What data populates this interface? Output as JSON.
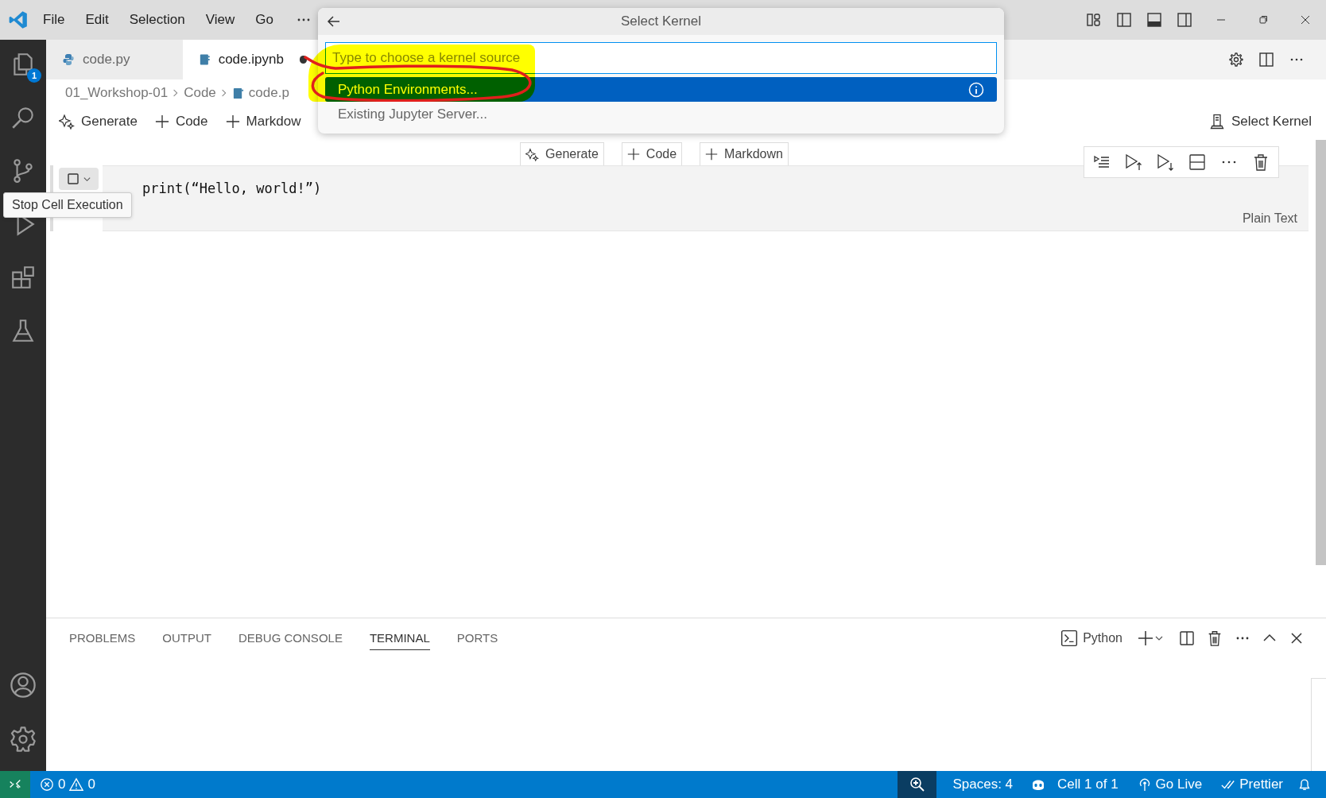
{
  "menu": [
    "File",
    "Edit",
    "Selection",
    "View",
    "Go"
  ],
  "activity_bar": {
    "explorer_badge": "1"
  },
  "tabs": [
    {
      "label": "code.py",
      "kind": "python",
      "selected": false,
      "dirty": false
    },
    {
      "label": "code.ipynb",
      "kind": "notebook",
      "selected": true,
      "dirty": true
    }
  ],
  "breadcrumb": [
    {
      "label": "01_Workshop-01",
      "kind": "folder"
    },
    {
      "label": "Code",
      "kind": "folder"
    },
    {
      "label": "code.p",
      "kind": "notebook"
    }
  ],
  "notebook_toolbar": {
    "items": [
      {
        "label": "Generate",
        "kind": "sparkle"
      },
      {
        "label": "Code",
        "kind": "plus"
      },
      {
        "label": "Markdow",
        "kind": "plus"
      }
    ],
    "kernel": "Select Kernel"
  },
  "insert_bar": [
    {
      "label": "Generate",
      "kind": "sparkle"
    },
    {
      "label": "Code",
      "kind": "plus"
    },
    {
      "label": "Markdown",
      "kind": "plus"
    }
  ],
  "cell": {
    "code": "print(“Hello, world!”)",
    "language": "Plain Text"
  },
  "tooltip": "Stop Cell Execution",
  "quick_pick": {
    "title": "Select Kernel",
    "placeholder": "Type to choose a kernel source",
    "items": [
      {
        "label": "Python Environments...",
        "selected": true
      },
      {
        "label": "Existing Jupyter Server...",
        "selected": false
      }
    ]
  },
  "panel": {
    "tabs": [
      {
        "label": "PROBLEMS",
        "selected": false
      },
      {
        "label": "OUTPUT",
        "selected": false
      },
      {
        "label": "DEBUG CONSOLE",
        "selected": false
      },
      {
        "label": "TERMINAL",
        "selected": true
      },
      {
        "label": "PORTS",
        "selected": false
      }
    ],
    "terminal": "Python"
  },
  "status_bar": {
    "errors": "0",
    "warnings": "0",
    "items": [
      {
        "label": "Spaces: 4",
        "kind": "plain"
      },
      {
        "label": "Cell 1 of 1",
        "kind": "copilot"
      },
      {
        "label": "Go Live",
        "kind": "live"
      },
      {
        "label": "Prettier",
        "kind": "formatter"
      }
    ]
  }
}
